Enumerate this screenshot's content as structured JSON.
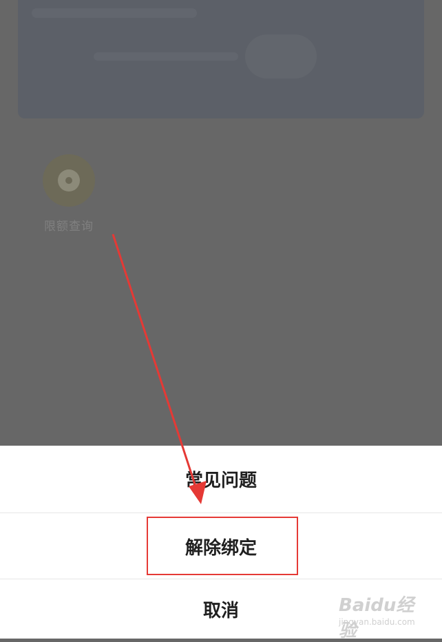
{
  "background": {
    "overlay_color": "#676767",
    "card_color": "#5c6068"
  },
  "tools": [
    {
      "label": "限额查询",
      "icon": "coin-icon"
    }
  ],
  "action_sheet": {
    "items": [
      {
        "label": "常见问题"
      },
      {
        "label": "解除绑定"
      },
      {
        "label": "取消"
      }
    ]
  },
  "annotation": {
    "highlight_color": "#e53935",
    "highlighted_item": "解除绑定"
  },
  "watermark": {
    "logo_text": "Baidu经验",
    "url": "jingyan.baidu.com"
  }
}
